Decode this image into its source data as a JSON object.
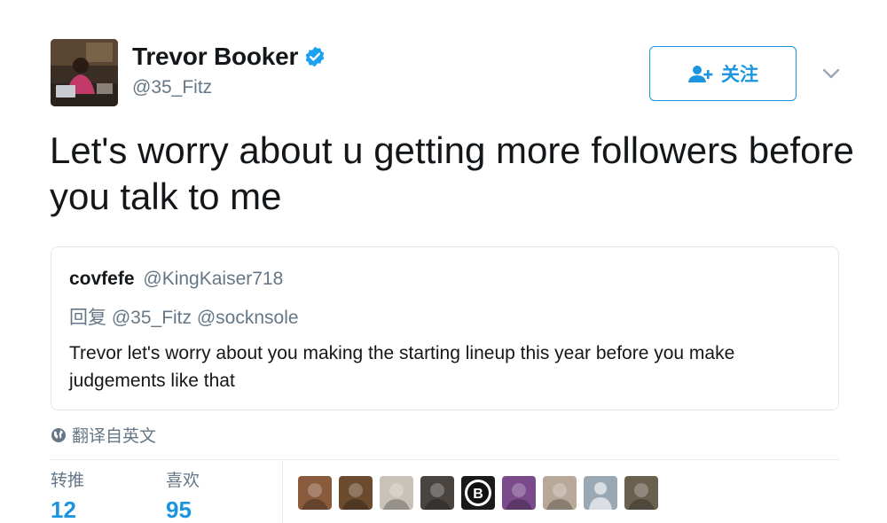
{
  "author": {
    "name": "Trevor Booker",
    "handle": "@35_Fitz",
    "verified": true,
    "avatar_icon": "profile-photo"
  },
  "follow_button": {
    "label": "关注",
    "icon": "add-user-icon",
    "color": "#1b95e0"
  },
  "tweet": {
    "text": "Let's worry about u getting more followers before you talk to me"
  },
  "quoted_tweet": {
    "name": "covfefe",
    "handle": "@KingKaiser718",
    "reply_line": "回复 @35_Fitz @socknsole",
    "text": "Trevor let's worry about you making the starting lineup this year before you make judgements like that"
  },
  "translate": {
    "label": "翻译自英文",
    "icon": "globe-icon"
  },
  "stats": {
    "retweets_label": "转推",
    "retweets_value": "12",
    "likes_label": "喜欢",
    "likes_value": "95"
  },
  "likers": [
    {
      "name": "liker-1",
      "color": "#8a5a3c"
    },
    {
      "name": "liker-2",
      "color": "#6b4a2e"
    },
    {
      "name": "liker-3",
      "color": "#c9c2b8"
    },
    {
      "name": "liker-4",
      "color": "#4a4440"
    },
    {
      "name": "liker-5",
      "color": "#1a1a1a"
    },
    {
      "name": "liker-6",
      "color": "#7a4a8a"
    },
    {
      "name": "liker-7",
      "color": "#b8a89a"
    },
    {
      "name": "liker-8",
      "color": "#9aa8b4"
    },
    {
      "name": "liker-9",
      "color": "#6a6050"
    }
  ],
  "colors": {
    "accent": "#1b95e0",
    "text": "#14171a",
    "secondary": "#657786",
    "border": "#e1e8ed"
  }
}
